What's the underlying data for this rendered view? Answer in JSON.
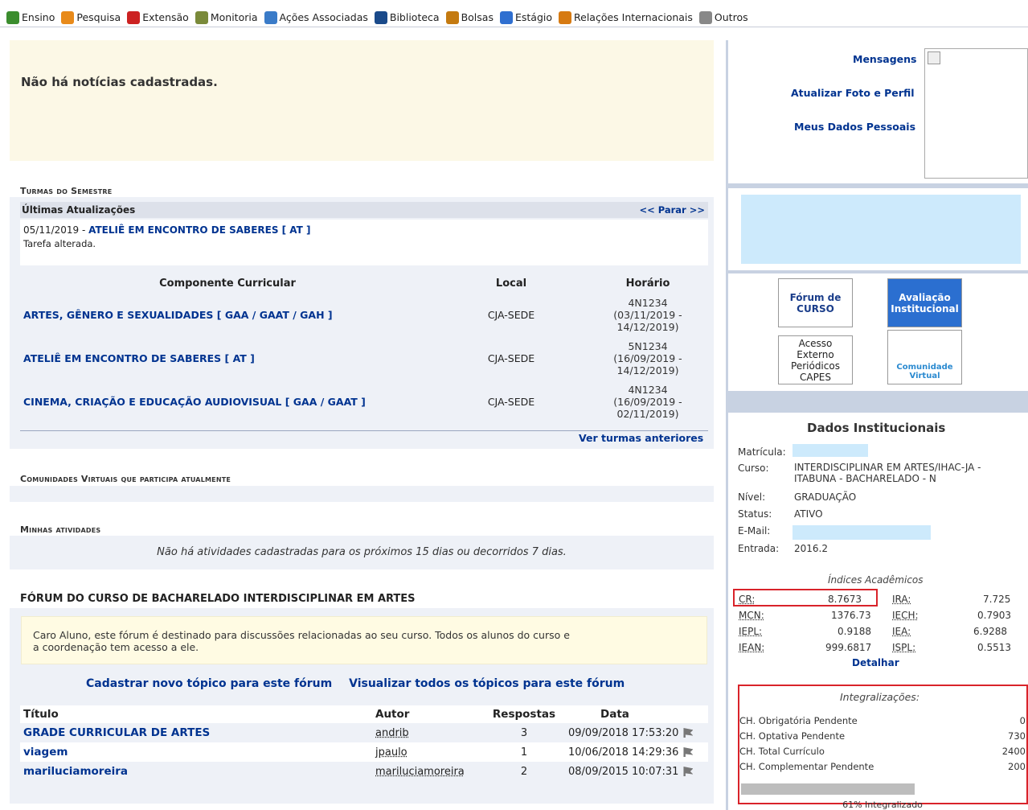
{
  "menu": [
    {
      "label": "Ensino",
      "icon": "book-icon",
      "color": "#3b8d2e"
    },
    {
      "label": "Pesquisa",
      "icon": "flask-icon",
      "color": "#e88a1a"
    },
    {
      "label": "Extensão",
      "icon": "heart-icon",
      "color": "#cc2222"
    },
    {
      "label": "Monitoria",
      "icon": "monitor-icon",
      "color": "#7a8a3a"
    },
    {
      "label": "Ações Associadas",
      "icon": "gears-icon",
      "color": "#3a7bc8"
    },
    {
      "label": "Biblioteca",
      "icon": "library-icon",
      "color": "#1a4a8a"
    },
    {
      "label": "Bolsas",
      "icon": "person-icon",
      "color": "#c47a10"
    },
    {
      "label": "Estágio",
      "icon": "badge-icon",
      "color": "#2f6fd0"
    },
    {
      "label": "Relações Internacionais",
      "icon": "globe-icon",
      "color": "#d67a12"
    },
    {
      "label": "Outros",
      "icon": "printer-icon",
      "color": "#888888"
    }
  ],
  "news": {
    "text": "Não há notícias cadastradas."
  },
  "turmas": {
    "section_title": "Turmas do Semestre",
    "updates_header": "Últimas Atualizações",
    "updates_nav": "<< Parar >>",
    "update_date": "05/11/2019 -",
    "update_course": "ATELIÊ EM ENCONTRO DE SABERES [ AT ]",
    "update_msg": "Tarefa alterada.",
    "col_componente": "Componente Curricular",
    "col_local": "Local",
    "col_horario": "Horário",
    "rows": [
      {
        "name": "ARTES, GÊNERO E SEXUALIDADES [ GAA / GAAT / GAH ]",
        "local": "CJA-SEDE",
        "h1": "4N1234",
        "h2": "(03/11/2019 -",
        "h3": "14/12/2019)"
      },
      {
        "name": "ATELIÊ EM ENCONTRO DE SABERES [ AT ]",
        "local": "CJA-SEDE",
        "h1": "5N1234",
        "h2": "(16/09/2019 -",
        "h3": "14/12/2019)"
      },
      {
        "name": "CINEMA, CRIAÇÃO E EDUCAÇÃO AUDIOVISUAL [ GAA / GAAT ]",
        "local": "CJA-SEDE",
        "h1": "4N1234",
        "h2": "(16/09/2019 -",
        "h3": "02/11/2019)"
      }
    ],
    "ver_anteriores": "Ver turmas anteriores"
  },
  "comunidades": {
    "section_title": "Comunidades Virtuais que participa atualmente"
  },
  "atividades": {
    "section_title": "Minhas atividades",
    "empty": "Não há atividades cadastradas para os próximos 15 dias ou decorridos 7 dias."
  },
  "forum": {
    "title": "FÓRUM DO CURSO DE BACHARELADO INTERDISCIPLINAR EM ARTES",
    "note_line1": "Caro Aluno, este fórum é destinado para discussões relacionadas ao seu curso. Todos os alunos do curso e",
    "note_line2": "a coordenação tem acesso a ele.",
    "link_new": "Cadastrar novo tópico para este fórum",
    "link_all": "Visualizar todos os tópicos para este fórum",
    "col_titulo": "Título",
    "col_autor": "Autor",
    "col_respostas": "Respostas",
    "col_data": "Data",
    "topics": [
      {
        "title": "GRADE CURRICULAR DE ARTES",
        "author": "andrib",
        "replies": "3",
        "date": "09/09/2018 17:53:20"
      },
      {
        "title": "viagem",
        "author": "jpaulo",
        "replies": "1",
        "date": "10/06/2018 14:29:36"
      },
      {
        "title": "mariluciamoreira",
        "author": "mariluciamoreira",
        "replies": "2",
        "date": "08/09/2015 10:07:31"
      }
    ]
  },
  "profile": {
    "mensagens": "Mensagens",
    "atualizar": "Atualizar Foto e Perfil",
    "dados": "Meus Dados Pessoais"
  },
  "badges": {
    "forum": "Fórum de CURSO",
    "avaliacao": "Avaliação Institucional",
    "capes": "Acesso Externo Periódicos CAPES",
    "comunidade": "Comunidade Virtual"
  },
  "dados": {
    "title": "Dados Institucionais",
    "matricula_label": "Matrícula:",
    "curso_label": "Curso:",
    "curso_l1": "INTERDISCIPLINAR EM ARTES/IHAC-JA -",
    "curso_l2": "ITABUNA - BACHARELADO - N",
    "nivel_label": "Nível:",
    "nivel": "GRADUAÇÃO",
    "status_label": "Status:",
    "status": "ATIVO",
    "email_label": "E-Mail:",
    "entrada_label": "Entrada:",
    "entrada": "2016.2"
  },
  "indices": {
    "title": "Índices Acadêmicos",
    "cr_label": "CR:",
    "cr": "8.7673",
    "ira_label": "IRA:",
    "ira": "7.725",
    "mcn_label": "MCN:",
    "mcn": "1376.73",
    "iech_label": "IECH:",
    "iech": "0.7903",
    "iepl_label": "IEPL:",
    "iepl": "0.9188",
    "iea_label": "IEA:",
    "iea": "6.9288",
    "iean_label": "IEAN:",
    "iean": "999.6817",
    "ispl_label": "ISPL:",
    "ispl": "0.5513",
    "detalhar": "Detalhar"
  },
  "integralizacoes": {
    "title": "Integralizações:",
    "rows": [
      {
        "label": "CH. Obrigatória Pendente",
        "value": "0"
      },
      {
        "label": "CH. Optativa Pendente",
        "value": "730"
      },
      {
        "label": "CH. Total Currículo",
        "value": "2400"
      },
      {
        "label": "CH. Complementar Pendente",
        "value": "200"
      }
    ],
    "progress": 0.61,
    "progress_label": "61% Integralizado"
  }
}
